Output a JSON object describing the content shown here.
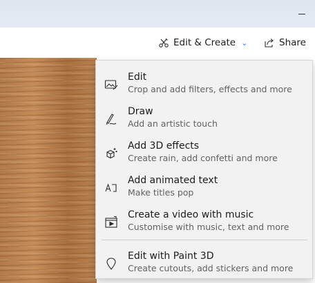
{
  "toolbar": {
    "edit_create_label": "Edit & Create",
    "share_label": "Share"
  },
  "menu": {
    "items": [
      {
        "title": "Edit",
        "subtitle": "Crop and add filters, effects and more",
        "icon": "edit-photo-icon"
      },
      {
        "title": "Draw",
        "subtitle": "Add an artistic touch",
        "icon": "draw-pen-icon"
      },
      {
        "title": "Add 3D effects",
        "subtitle": "Create rain, add confetti and more",
        "icon": "3d-effects-icon"
      },
      {
        "title": "Add animated text",
        "subtitle": "Make titles pop",
        "icon": "animated-text-icon"
      },
      {
        "title": "Create a video with music",
        "subtitle": "Customise with music, text and more",
        "icon": "video-music-icon"
      },
      {
        "title": "Edit with Paint 3D",
        "subtitle": "Create cutouts, add stickers and more",
        "icon": "paint-3d-icon"
      }
    ]
  },
  "colors": {
    "accent": "#1f7ad6",
    "menu_background": "#f2f2f2",
    "titlebar": "#e0e8f2"
  }
}
